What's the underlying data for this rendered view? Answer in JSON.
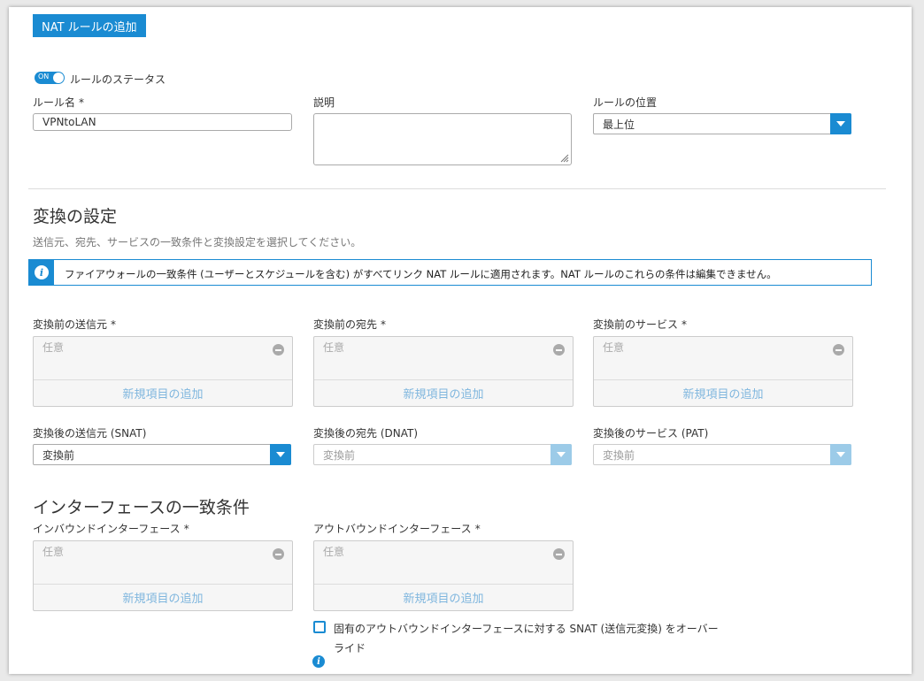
{
  "add_nat_rule_button": "NAT ルールの追加",
  "rule_status": {
    "toggle_text": "ON",
    "label": "ルールのステータス"
  },
  "rule_name": {
    "label": "ルール名",
    "required": "*",
    "value": "VPNtoLAN"
  },
  "description": {
    "label": "説明",
    "value": ""
  },
  "rule_position": {
    "label": "ルールの位置",
    "value": "最上位"
  },
  "translation_settings": {
    "title": "変換の設定",
    "subtitle": "送信元、宛先、サービスの一致条件と変換設定を選択してください。",
    "info_message": "ファイアウォールの一致条件 (ユーザーとスケジュールを含む) がすべてリンク NAT ルールに適用されます。NAT ルールのこれらの条件は編集できません。"
  },
  "original_source": {
    "label": "変換前の送信元",
    "required": "*",
    "placeholder": "任意",
    "add_label": "新規項目の追加"
  },
  "original_destination": {
    "label": "変換前の宛先",
    "required": "*",
    "placeholder": "任意",
    "add_label": "新規項目の追加"
  },
  "original_service": {
    "label": "変換前のサービス",
    "required": "*",
    "placeholder": "任意",
    "add_label": "新規項目の追加"
  },
  "translated_source": {
    "label": "変換後の送信元 (SNAT)",
    "value": "変換前"
  },
  "translated_destination": {
    "label": "変換後の宛先 (DNAT)",
    "value": "変換前"
  },
  "translated_service": {
    "label": "変換後のサービス (PAT)",
    "value": "変換前"
  },
  "interface_matching": {
    "title": "インターフェースの一致条件"
  },
  "inbound_interface": {
    "label": "インバウンドインターフェース",
    "required": "*",
    "placeholder": "任意",
    "add_label": "新規項目の追加"
  },
  "outbound_interface": {
    "label": "アウトバウンドインターフェース",
    "required": "*",
    "placeholder": "任意",
    "add_label": "新規項目の追加"
  },
  "override_snat": {
    "label": "固有のアウトバウンドインターフェースに対する SNAT (送信元変換) をオーバーライド",
    "checked": false
  },
  "colors": {
    "accent": "#1a8bd2",
    "accent_disabled": "#9ccbe8",
    "add_link": "#7fb6de"
  }
}
